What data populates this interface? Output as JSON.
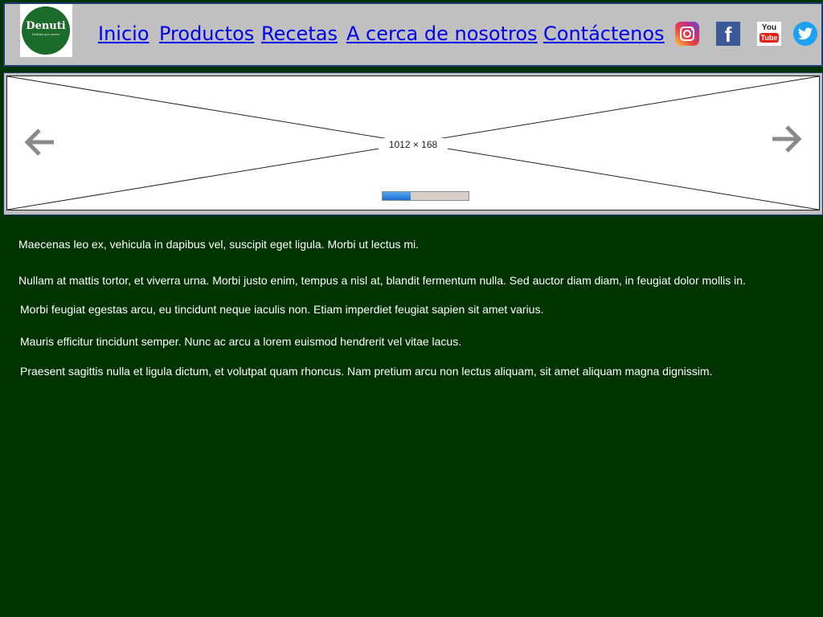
{
  "header": {
    "logo": {
      "brand": "Denuti",
      "tagline": "Delicias que nutren"
    },
    "nav": [
      {
        "label": "Inicio"
      },
      {
        "label": "Productos"
      },
      {
        "label": "Recetas"
      },
      {
        "label": "A cerca de nosotros"
      },
      {
        "label": "Contáctenos"
      }
    ],
    "social": [
      {
        "icon": "instagram-icon"
      },
      {
        "icon": "facebook-icon",
        "glyph": "f"
      },
      {
        "icon": "youtube-icon",
        "text_top": "You",
        "text_bottom": "Tube"
      },
      {
        "icon": "twitter-icon"
      }
    ]
  },
  "slider": {
    "placeholder_label": "1012 × 168",
    "prev_icon": "arrow-left-icon",
    "next_icon": "arrow-right-icon",
    "progress": 0.33
  },
  "content": {
    "paragraphs": [
      "Maecenas leo ex, vehicula in dapibus vel, suscipit eget ligula. Morbi ut lectus mi.",
      "Nullam at mattis tortor, et viverra urna. Morbi justo enim, tempus a nisl at, blandit fermentum nulla. Sed auctor diam diam, in feugiat dolor mollis in.",
      "Morbi feugiat egestas arcu, eu tincidunt neque iaculis non. Etiam imperdiet feugiat sapien sit amet varius.",
      "Mauris efficitur tincidunt semper. Nunc ac arcu a lorem euismod hendrerit vel vitae lacus.",
      "Praesent sagittis nulla et ligula dictum, et volutpat quam rhoncus. Nam pretium arcu non lectus aliquam, sit amet aliquam magna dignissim."
    ]
  },
  "colors": {
    "page_background": "#003300",
    "header_background": "#c0c0c0",
    "link": "#0000ee",
    "text": "#ffffff"
  }
}
